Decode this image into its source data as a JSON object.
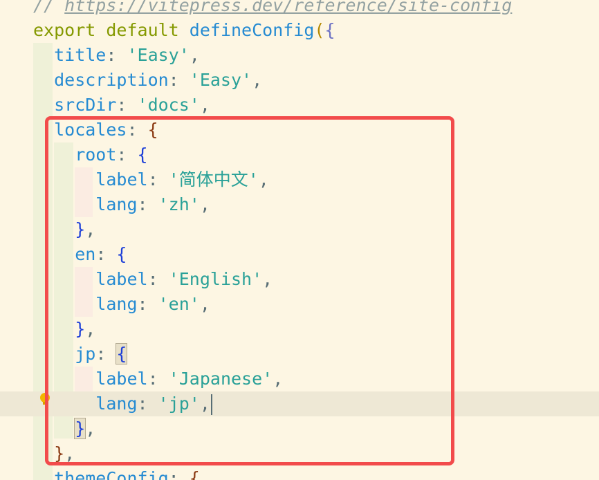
{
  "editor": {
    "lines": [
      {
        "id": "comment",
        "tokens": [
          [
            "comment",
            "// "
          ],
          [
            "link",
            "https://vitepress.dev/reference/site-config"
          ]
        ]
      },
      {
        "id": "export",
        "tokens": [
          [
            "keyword",
            "export"
          ],
          [
            "punc",
            " "
          ],
          [
            "keyword",
            "default"
          ],
          [
            "punc",
            " "
          ],
          [
            "func",
            "defineConfig"
          ],
          [
            "brace1",
            "("
          ],
          [
            "brace2",
            "{"
          ]
        ]
      },
      {
        "id": "title",
        "tokens": [
          [
            "prop",
            "  title"
          ],
          [
            "punc",
            ": "
          ],
          [
            "str",
            "'Easy'"
          ],
          [
            "punc",
            ","
          ]
        ]
      },
      {
        "id": "description",
        "tokens": [
          [
            "prop",
            "  description"
          ],
          [
            "punc",
            ": "
          ],
          [
            "str",
            "'Easy'"
          ],
          [
            "punc",
            ","
          ]
        ]
      },
      {
        "id": "srcdir",
        "tokens": [
          [
            "prop",
            "  srcDir"
          ],
          [
            "punc",
            ": "
          ],
          [
            "str",
            "'docs'"
          ],
          [
            "punc",
            ","
          ]
        ]
      },
      {
        "id": "locales",
        "tokens": [
          [
            "prop",
            "  locales"
          ],
          [
            "punc",
            ": "
          ],
          [
            "brace-brown",
            "{"
          ]
        ]
      },
      {
        "id": "root",
        "tokens": [
          [
            "prop",
            "    root"
          ],
          [
            "punc",
            ": "
          ],
          [
            "brace-blue",
            "{"
          ]
        ]
      },
      {
        "id": "root-label",
        "tokens": [
          [
            "prop",
            "      label"
          ],
          [
            "punc",
            ": "
          ],
          [
            "str",
            "'简体中文'"
          ],
          [
            "punc",
            ","
          ]
        ]
      },
      {
        "id": "root-lang",
        "tokens": [
          [
            "prop",
            "      lang"
          ],
          [
            "punc",
            ": "
          ],
          [
            "str",
            "'zh'"
          ],
          [
            "punc",
            ","
          ]
        ]
      },
      {
        "id": "root-close",
        "tokens": [
          [
            "brace-blue",
            "    }"
          ],
          [
            "punc",
            ","
          ]
        ]
      },
      {
        "id": "en",
        "tokens": [
          [
            "prop",
            "    en"
          ],
          [
            "punc",
            ": "
          ],
          [
            "brace-blue",
            "{"
          ]
        ]
      },
      {
        "id": "en-label",
        "tokens": [
          [
            "prop",
            "      label"
          ],
          [
            "punc",
            ": "
          ],
          [
            "str",
            "'English'"
          ],
          [
            "punc",
            ","
          ]
        ]
      },
      {
        "id": "en-lang",
        "tokens": [
          [
            "prop",
            "      lang"
          ],
          [
            "punc",
            ": "
          ],
          [
            "str",
            "'en'"
          ],
          [
            "punc",
            ","
          ]
        ]
      },
      {
        "id": "en-close",
        "tokens": [
          [
            "brace-blue",
            "    }"
          ],
          [
            "punc",
            ","
          ]
        ]
      },
      {
        "id": "jp",
        "tokens": [
          [
            "prop",
            "    jp"
          ],
          [
            "punc",
            ": "
          ],
          [
            "brace-blue-match",
            "{"
          ]
        ]
      },
      {
        "id": "jp-label",
        "tokens": [
          [
            "prop",
            "      label"
          ],
          [
            "punc",
            ": "
          ],
          [
            "str",
            "'Japanese'"
          ],
          [
            "punc",
            ","
          ]
        ]
      },
      {
        "id": "jp-lang",
        "tokens": [
          [
            "prop",
            "      lang"
          ],
          [
            "punc",
            ": "
          ],
          [
            "str",
            "'jp'"
          ],
          [
            "punc",
            ","
          ]
        ],
        "cursor": true,
        "current": true
      },
      {
        "id": "jp-close",
        "tokens": [
          [
            "punc",
            "    "
          ],
          [
            "brace-blue-match",
            "}"
          ],
          [
            "punc",
            ","
          ]
        ]
      },
      {
        "id": "locales-close",
        "tokens": [
          [
            "brace-brown",
            "  }"
          ],
          [
            "punc",
            ","
          ]
        ]
      },
      {
        "id": "themeconfig",
        "tokens": [
          [
            "prop",
            "  themeConfig"
          ],
          [
            "punc",
            ": "
          ],
          [
            "brace-brown",
            "{"
          ]
        ]
      }
    ]
  },
  "colors": {
    "background": "#fdf6e3",
    "highlight_border": "#f24b4b",
    "current_line": "#eee8d5"
  },
  "icons": {
    "lightbulb": "lightbulb-icon"
  }
}
